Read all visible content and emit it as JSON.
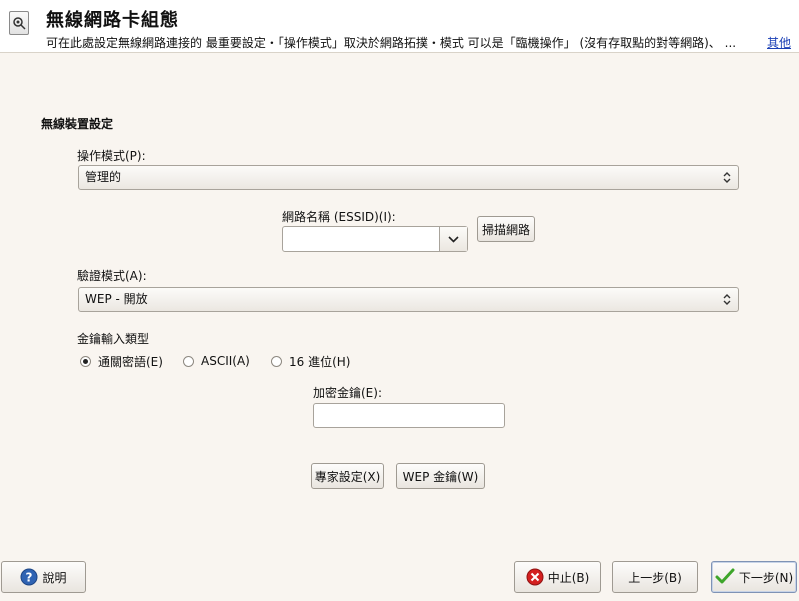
{
  "header": {
    "title": "無線網路卡組態",
    "description": "可在此處設定無線網路連接的 最重要設定・「操作模式」取決於網路拓撲・模式 可以是「臨機操作」 (沒有存取點的對等網路)、  ...",
    "more_link": "其他",
    "icon": "network-config-icon"
  },
  "section_title": "無線裝置設定",
  "operation_mode": {
    "label": "操作模式(P):",
    "value": "管理的"
  },
  "essid": {
    "label": "網路名稱 (ESSID)(I):",
    "value": "",
    "scan_button": "掃描網路"
  },
  "auth_mode": {
    "label": "驗證模式(A):",
    "value": "WEP - 開放"
  },
  "key_input_type": {
    "label": "金鑰輸入類型",
    "options": [
      "通關密語(E)",
      "ASCII(A)",
      "16 進位(H)"
    ],
    "selected": "通關密語(E)"
  },
  "encryption_key": {
    "label": "加密金鑰(E):",
    "value": ""
  },
  "buttons": {
    "expert": "專家設定(X)",
    "wep_keys": "WEP 金鑰(W)",
    "help": "說明",
    "abort": "中止(B)",
    "back": "上一步(B)",
    "next": "下一步(N)"
  },
  "colors": {
    "background": "#f9f5f0",
    "link": "#1a3fb5",
    "help_icon": "#2f63b3",
    "abort_icon": "#d42020",
    "next_icon": "#3da52a"
  }
}
